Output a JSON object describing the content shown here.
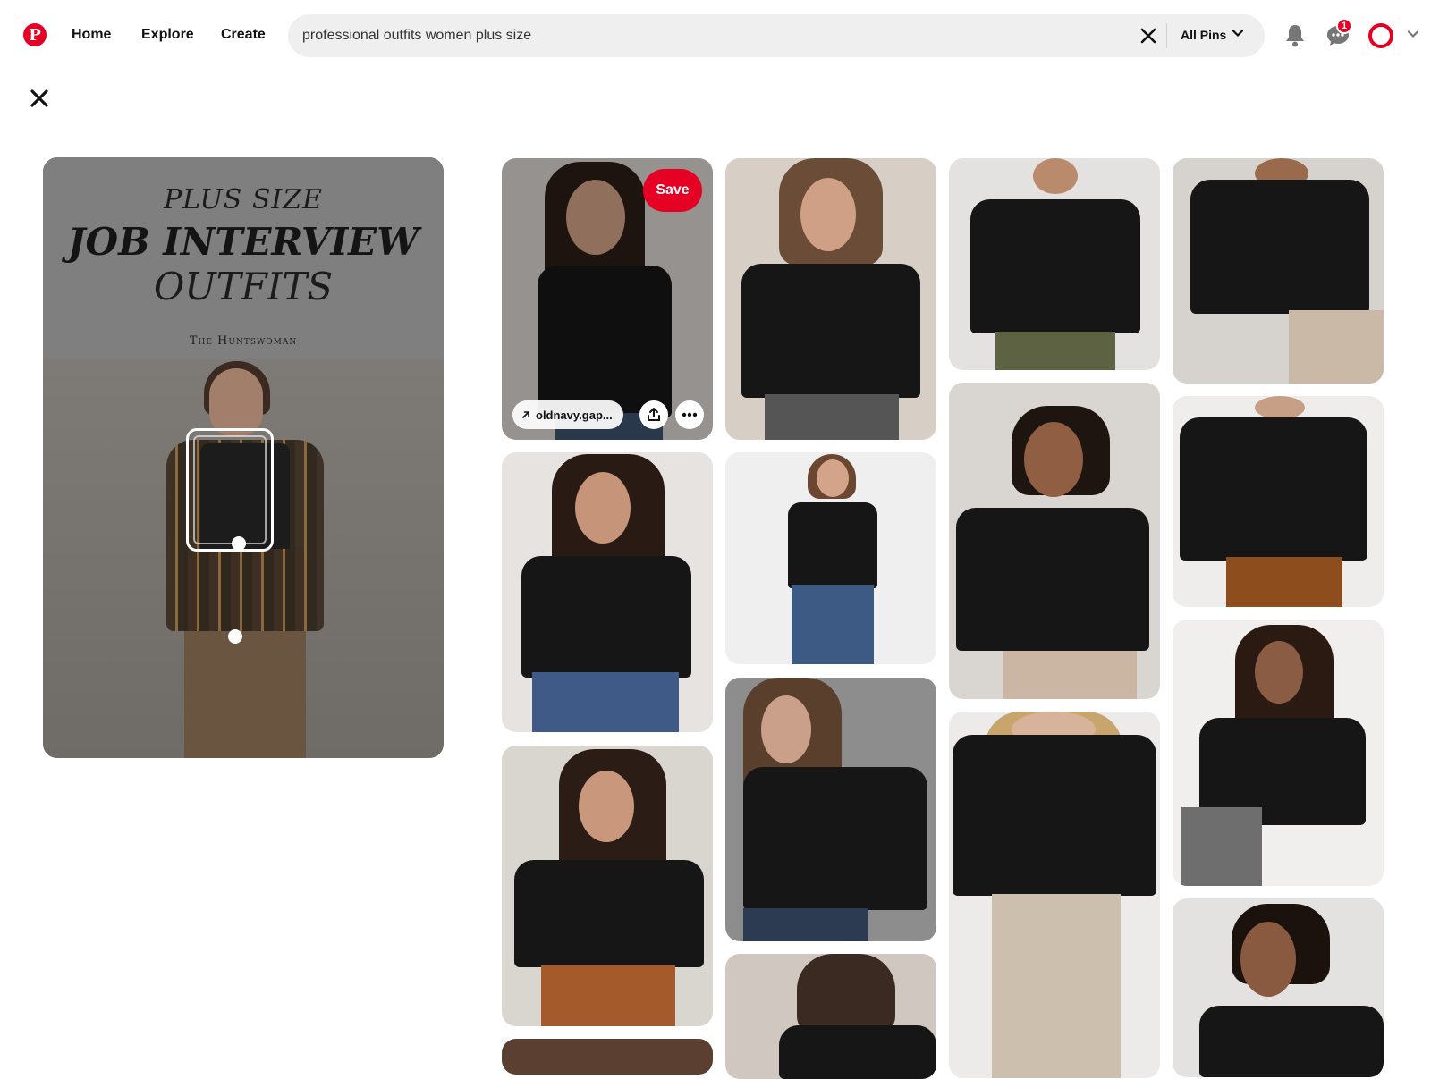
{
  "header": {
    "logo_letter": "P",
    "nav": {
      "home": "Home",
      "explore": "Explore",
      "create": "Create"
    },
    "search": {
      "value": "professional outfits women plus size"
    },
    "filter": {
      "label": "All Pins"
    },
    "messages_badge": "1",
    "icons": {
      "search_clear": "close-icon",
      "filter_chevron": "chevron-down-icon",
      "notifications": "bell-icon",
      "messages": "chat-bubble-icon",
      "account_chevron": "chevron-down-icon"
    }
  },
  "closeup": {
    "close_icon": "close-icon",
    "main_pin": {
      "title_line1": "PLUS SIZE",
      "title_line2": "JOB INTERVIEW",
      "title_line3": "OUTFITS",
      "brand": "The Huntswoman"
    }
  },
  "hovered_pin": {
    "save_label": "Save",
    "link_label": "oldnavy.gap...",
    "icons": {
      "link": "arrow-up-right-icon",
      "share": "share-icon",
      "more": "more-horizontal-icon"
    }
  },
  "colors": {
    "brand_red": "#e60023",
    "search_bg": "#efefef"
  }
}
